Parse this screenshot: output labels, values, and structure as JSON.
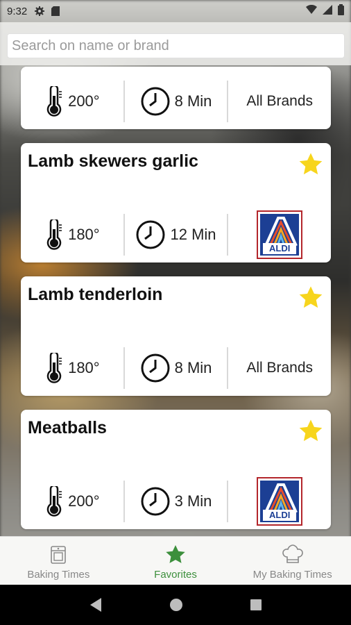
{
  "status": {
    "time": "9:32",
    "icons": [
      "gear-icon",
      "sd-card-icon",
      "wifi-icon",
      "signal-icon",
      "battery-icon"
    ]
  },
  "search": {
    "placeholder": "Search on name or brand"
  },
  "cards": [
    {
      "title": "",
      "temp": "200°",
      "time": "8 Min",
      "brand": "All Brands",
      "favorite": true
    },
    {
      "title": "Lamb skewers garlic",
      "temp": "180°",
      "time": "12 Min",
      "brand": "ALDI",
      "brand_logo": "aldi-logo",
      "favorite": true
    },
    {
      "title": "Lamb tenderloin",
      "temp": "180°",
      "time": "8 Min",
      "brand": "All Brands",
      "favorite": true
    },
    {
      "title": "Meatballs",
      "temp": "200°",
      "time": "3 Min",
      "brand": "ALDI",
      "brand_logo": "aldi-logo",
      "favorite": true
    }
  ],
  "bottom_nav": {
    "items": [
      {
        "label": "Baking Times",
        "icon": "oven-icon",
        "active": false
      },
      {
        "label": "Favorites",
        "icon": "star-icon",
        "active": true
      },
      {
        "label": "My Baking Times",
        "icon": "chef-hat-icon",
        "active": false
      }
    ]
  },
  "colors": {
    "accent": "#3c8f3c",
    "star": "#f7d51d",
    "aldi_blue": "#1c3f94",
    "aldi_red": "#b3262b"
  }
}
